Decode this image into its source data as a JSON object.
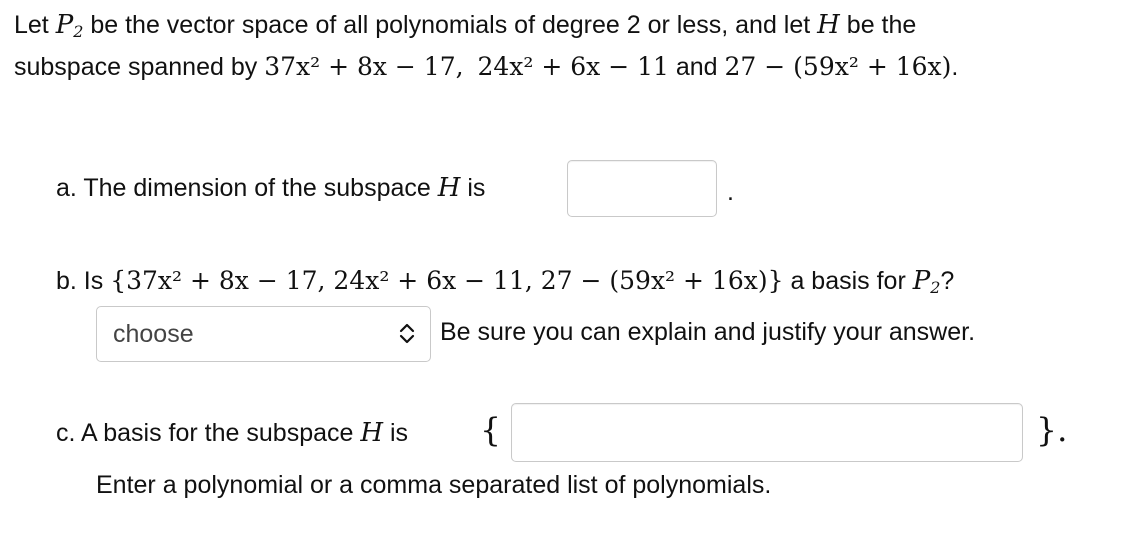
{
  "intro": {
    "line1_a": "Let ",
    "space_symbol": "P",
    "space_sub": "2",
    "line1_b": " be the vector space of all polynomials of degree 2 or less, and let ",
    "subspace_symbol": "H",
    "line1_c": " be the",
    "line2_a": "subspace spanned by ",
    "p1": "37x² + 8x − 17,",
    "p2": "24x² + 6x − 11",
    "and": " and ",
    "p3": "27 − (59x² + 16x)",
    "end": "."
  },
  "part_a": {
    "label": "a. The dimension of the subspace ",
    "symbol": "H",
    "suffix": " is",
    "answer_value": "",
    "after": "."
  },
  "part_b": {
    "prefix": "b. Is ",
    "set_text": "{37x² + 8x − 17, 24x² + 6x − 11, 27 − (59x² + 16x)}",
    "suffix": " a basis for ",
    "space_symbol": "P",
    "space_sub": "2",
    "question_mark": "?",
    "select_value": "choose",
    "hint": "Be sure you can explain and justify your answer."
  },
  "part_c": {
    "label": "c. A basis for the subspace ",
    "symbol": "H",
    "is": " is",
    "open_brace": "{",
    "close_brace": "}.",
    "answer_value": "",
    "instruction": "Enter a polynomial or a comma separated list of polynomials."
  }
}
